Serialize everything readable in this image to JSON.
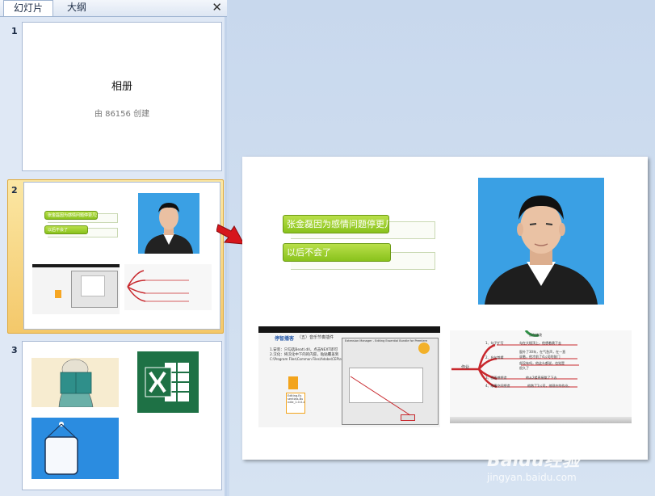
{
  "panel": {
    "tabs": [
      {
        "label": "幻灯片"
      },
      {
        "label": "大纲"
      }
    ],
    "close": "✕"
  },
  "slides": [
    {
      "number": "1",
      "title": "相册",
      "subtitle": "由 86156 创建"
    },
    {
      "number": "2",
      "texts": [
        "张金磊因为感情问题停更几天",
        "以后不会了"
      ]
    },
    {
      "number": "3"
    }
  ],
  "main": {
    "texts": [
      "张金磊因为感情问题停更几天",
      "以后不会了"
    ],
    "screenshot": {
      "brand": "停智播客",
      "header": "（五）音乐节奏插件",
      "lines": [
        "1.安装：只勾选Beatl.dll，点击NEXT即可",
        "2.汉化：将汉化中下的的内容，粘贴覆盖到",
        "C:\\Program Files\\Common Files\\Adobe\\CEP\\extensions"
      ],
      "dialog_title": "Extension Manager - Editing Essential Bundle for Premiere",
      "file_label": "Editing.Es sentials.Bu ndle_1.0.0.zxp"
    },
    "mindmap": {
      "root": "作业",
      "items": [
        "1、勾子扩写",
        "2、台句剪辑",
        "3、画面感塑造",
        "4、故事空间塑造"
      ],
      "notes": [
        "正在修改",
        "勾在大楼顶上，他想着跳下去",
        "窗外了30年，在气急声，在一直说着，他才前了4公司的前门",
        "部没有吗，他这么都说，也觉是 很久了",
        "他从2楼直接跳了下去",
        "他跑了1公司，他现在的作业。"
      ]
    }
  },
  "watermark": {
    "line1": "Baidu经验",
    "line2": "jingyan.baidu.com"
  },
  "colors": {
    "selection": "#f4c86a",
    "green": "#8cc524",
    "photo_bg": "#3aa0e4",
    "mindmap_red": "#c8282d",
    "excel": "#1e7145"
  }
}
